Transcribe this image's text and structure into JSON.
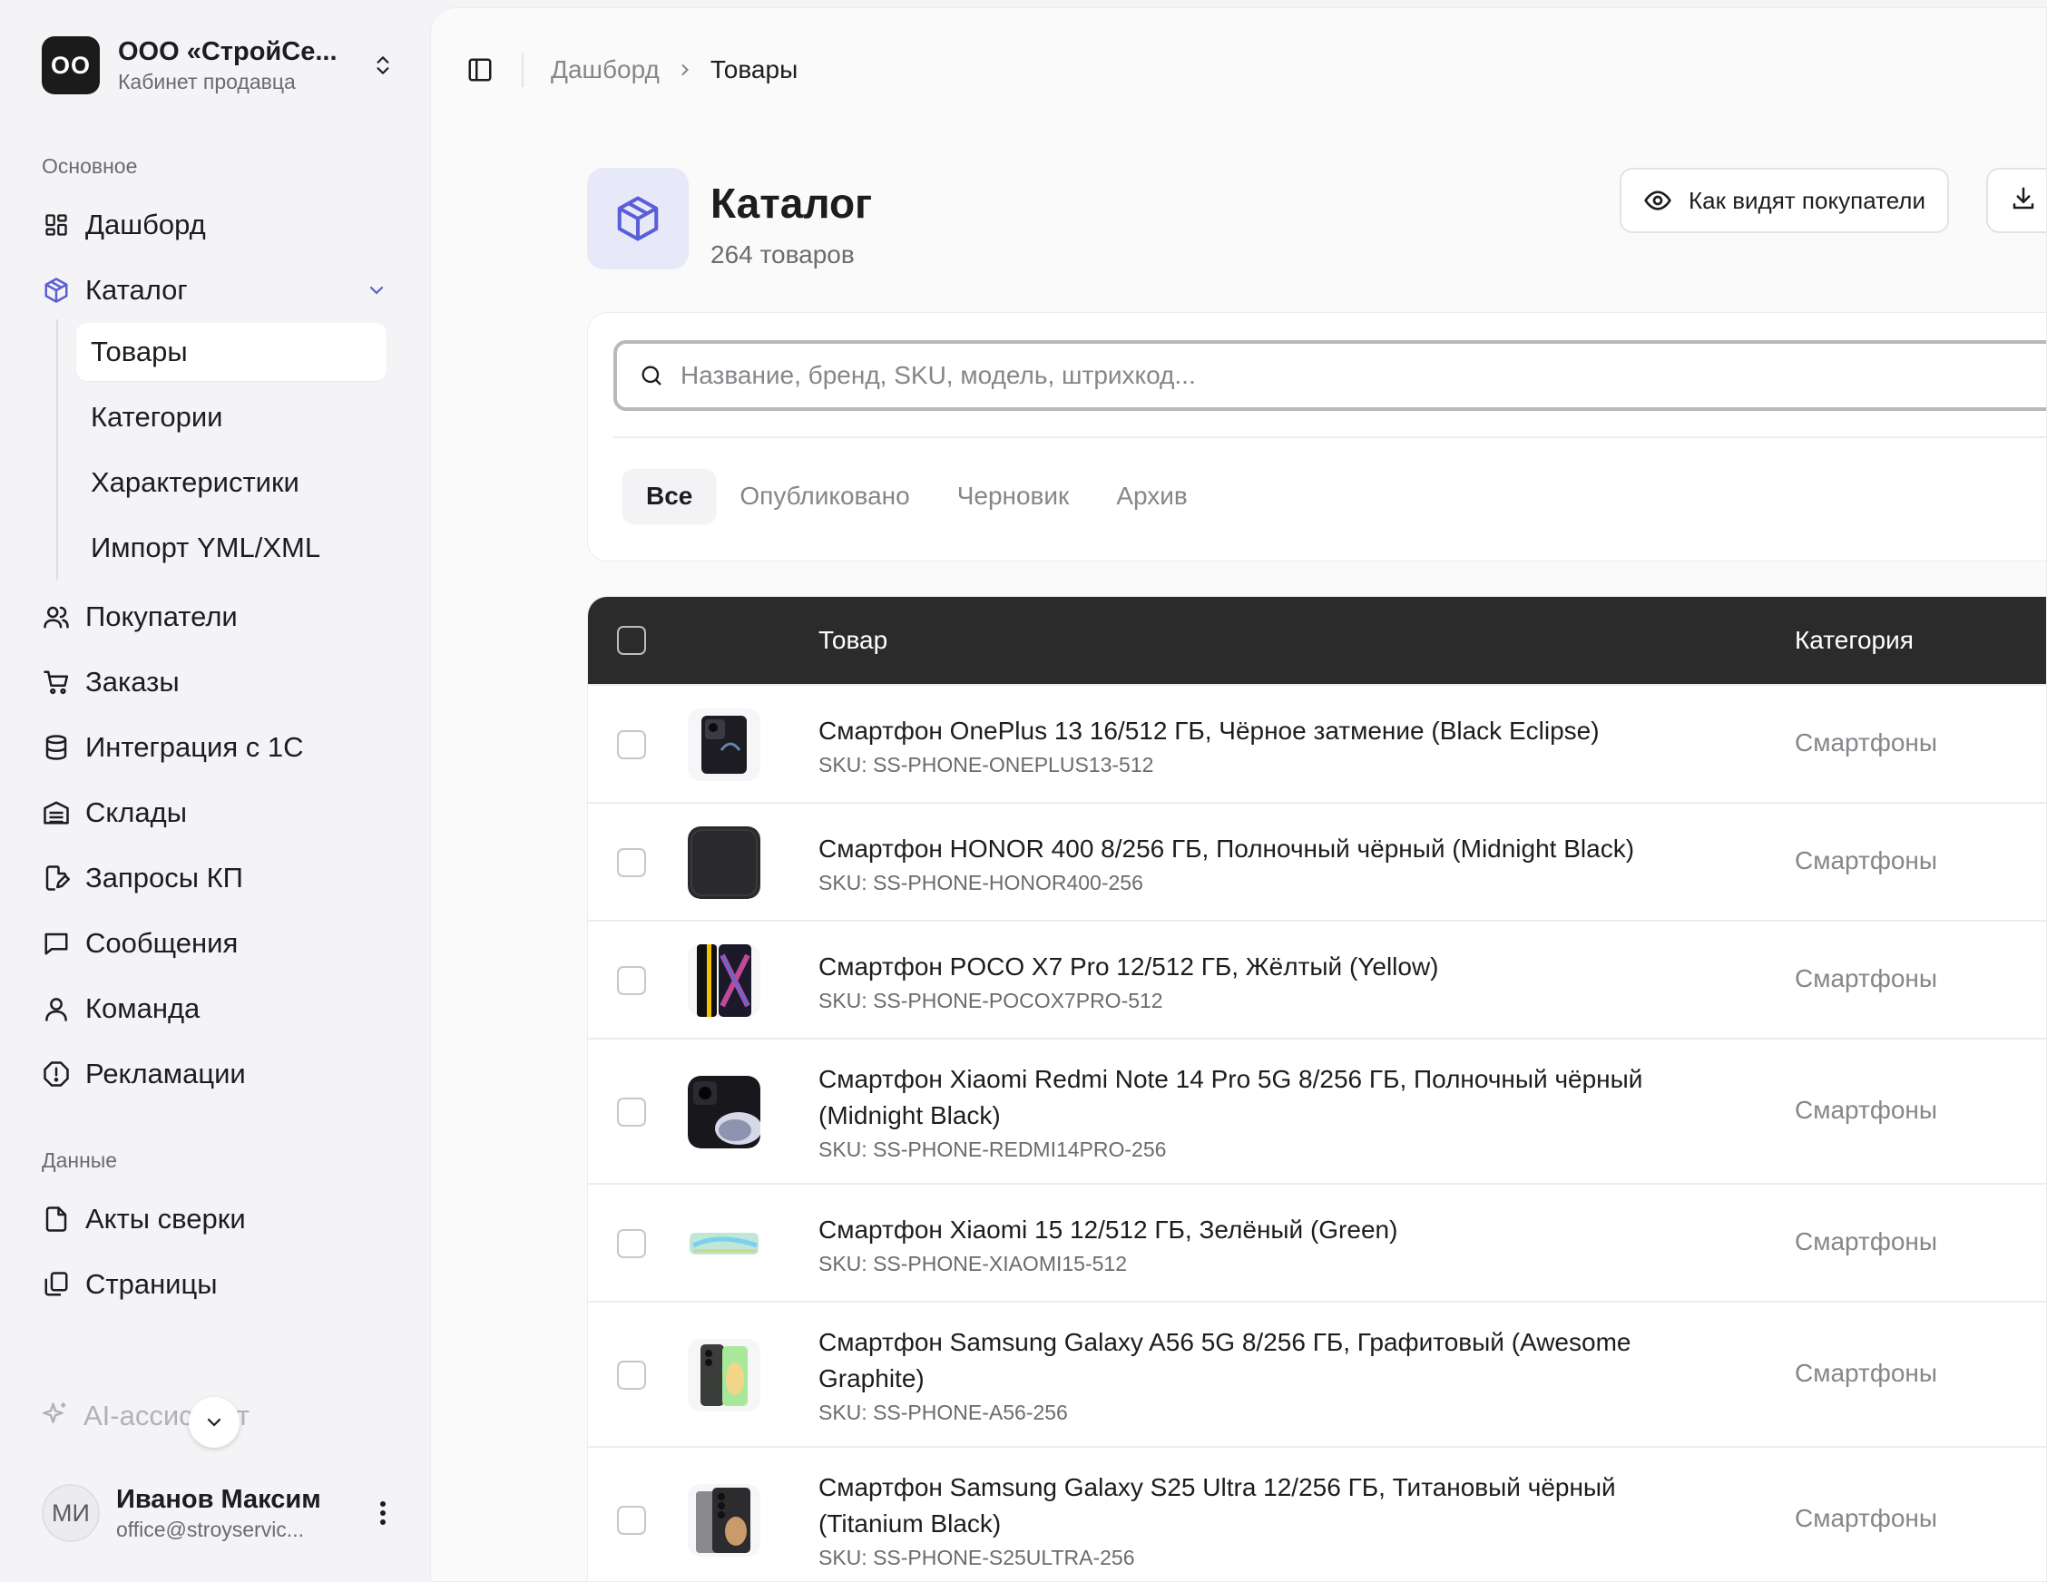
{
  "org": {
    "initials": "OO",
    "name": "ООО «СтройСе...",
    "subtitle": "Кабинет продавца"
  },
  "sidebar": {
    "section_main": "Основное",
    "section_data": "Данные",
    "items": [
      {
        "label": "Дашборд",
        "icon": "dashboard-icon"
      },
      {
        "label": "Каталог",
        "icon": "box-icon"
      },
      {
        "label": "Покупатели",
        "icon": "users-icon"
      },
      {
        "label": "Заказы",
        "icon": "cart-icon"
      },
      {
        "label": "Интеграция с 1С",
        "icon": "database-icon"
      },
      {
        "label": "Склады",
        "icon": "warehouse-icon"
      },
      {
        "label": "Запросы КП",
        "icon": "file-edit-icon"
      },
      {
        "label": "Сообщения",
        "icon": "message-icon"
      },
      {
        "label": "Команда",
        "icon": "user-icon"
      },
      {
        "label": "Рекламации",
        "icon": "alert-icon"
      }
    ],
    "catalog_sub": [
      "Товары",
      "Категории",
      "Характеристики",
      "Импорт YML/XML"
    ],
    "data_items": [
      {
        "label": "Акты сверки",
        "icon": "file-check-icon"
      },
      {
        "label": "Страницы",
        "icon": "pages-icon"
      }
    ],
    "ai_label": "AI-ассистент"
  },
  "user": {
    "initials": "МИ",
    "name": "Иванов Максим",
    "email": "office@stroyservic..."
  },
  "breadcrumb": {
    "home": "Дашборд",
    "current": "Товары"
  },
  "page": {
    "title": "Каталог",
    "count": "264 товаров",
    "buyers_button": "Как видят покупатели"
  },
  "search": {
    "placeholder": "Название, бренд, SKU, модель, штрихкод..."
  },
  "tabs": [
    "Все",
    "Опубликовано",
    "Черновик",
    "Архив"
  ],
  "table": {
    "columns": {
      "product": "Товар",
      "category": "Категория"
    },
    "rows": [
      {
        "name": "Смартфон OnePlus 13 16/512 ГБ, Чёрное затмение (Black Eclipse)",
        "sku": "SKU: SS-PHONE-ONEPLUS13-512",
        "category": "Смартфоны",
        "thumb": "#1c1c22"
      },
      {
        "name": "Смартфон HONOR 400 8/256 ГБ, Полночный чёрный (Midnight Black)",
        "sku": "SKU: SS-PHONE-HONOR400-256",
        "category": "Смартфоны",
        "thumb": "#2a2a2c"
      },
      {
        "name": "Смартфон POCO X7 Pro 12/512 ГБ, Жёлтый (Yellow)",
        "sku": "SKU: SS-PHONE-POCOX7PRO-512",
        "category": "Смартфоны",
        "thumb": "#1a1a2a"
      },
      {
        "name": "Смартфон Xiaomi Redmi Note 14 Pro 5G 8/256 ГБ, Полночный чёрный (Midnight Black)",
        "sku": "SKU: SS-PHONE-REDMI14PRO-256",
        "category": "Смартфоны",
        "thumb": "#18181c"
      },
      {
        "name": "Смартфон Xiaomi 15 12/512 ГБ, Зелёный (Green)",
        "sku": "SKU: SS-PHONE-XIAOMI15-512",
        "category": "Смартфоны",
        "thumb": "#bfe6d6"
      },
      {
        "name": "Смартфон Samsung Galaxy A56 5G 8/256 ГБ, Графитовый (Awesome Graphite)",
        "sku": "SKU: SS-PHONE-A56-256",
        "category": "Смартфоны",
        "thumb": "#3a3d3a"
      },
      {
        "name": "Смартфон Samsung Galaxy S25 Ultra 12/256 ГБ, Титановый чёрный (Titanium Black)",
        "sku": "SKU: SS-PHONE-S25ULTRA-256",
        "category": "Смартфоны",
        "thumb": "#2c2c2e"
      }
    ]
  },
  "colors": {
    "accent": "#5b5fd6",
    "header_bg": "#2b2b2b"
  }
}
